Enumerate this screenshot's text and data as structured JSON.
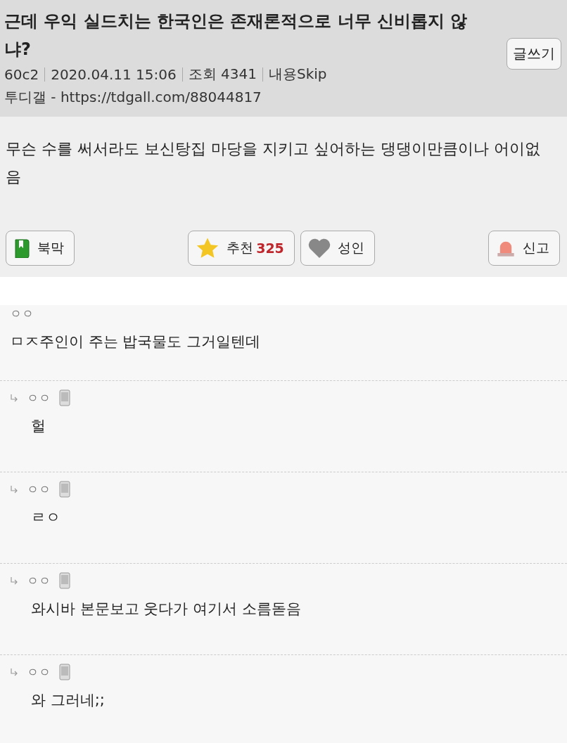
{
  "post": {
    "title": "근데 우익 실드치는 한국인은 존재론적으로 너무 신비롭지 않냐?",
    "meta": [
      "60c2",
      "2020.04.11 15:06",
      "조회 4341",
      "내용Skip"
    ],
    "source": "투디갤 - https://tdgall.com/88044817",
    "write_button": "글쓰기"
  },
  "body": "무슨 수를 써서라도 보신탕집 마당을 지키고 싶어하는 댕댕이만큼이나 어이없음",
  "actions": [
    {
      "kind": "bookmark",
      "label": "북막"
    },
    {
      "kind": "recommend",
      "label": "추천",
      "count": "325"
    },
    {
      "kind": "adult",
      "label": "성인"
    },
    {
      "kind": "report",
      "label": "신고"
    }
  ],
  "comments": [
    {
      "kind": "comment",
      "author": "ㅇㅇ",
      "mobile": false,
      "text": "ㅁㅈ주인이 주는 밥국물도 그거일텐데"
    },
    {
      "kind": "reply",
      "author": "ㅇㅇ",
      "mobile": true,
      "text": "헐"
    },
    {
      "kind": "reply",
      "author": "ㅇㅇ",
      "mobile": true,
      "text": "ㄹㅇ"
    },
    {
      "kind": "reply",
      "author": "ㅇㅇ",
      "mobile": true,
      "text": "와시바 본문보고 웃다가 여기서 소름돋음"
    },
    {
      "kind": "reply",
      "author": "ㅇㅇ",
      "mobile": true,
      "text": "와 그러네;;"
    }
  ]
}
